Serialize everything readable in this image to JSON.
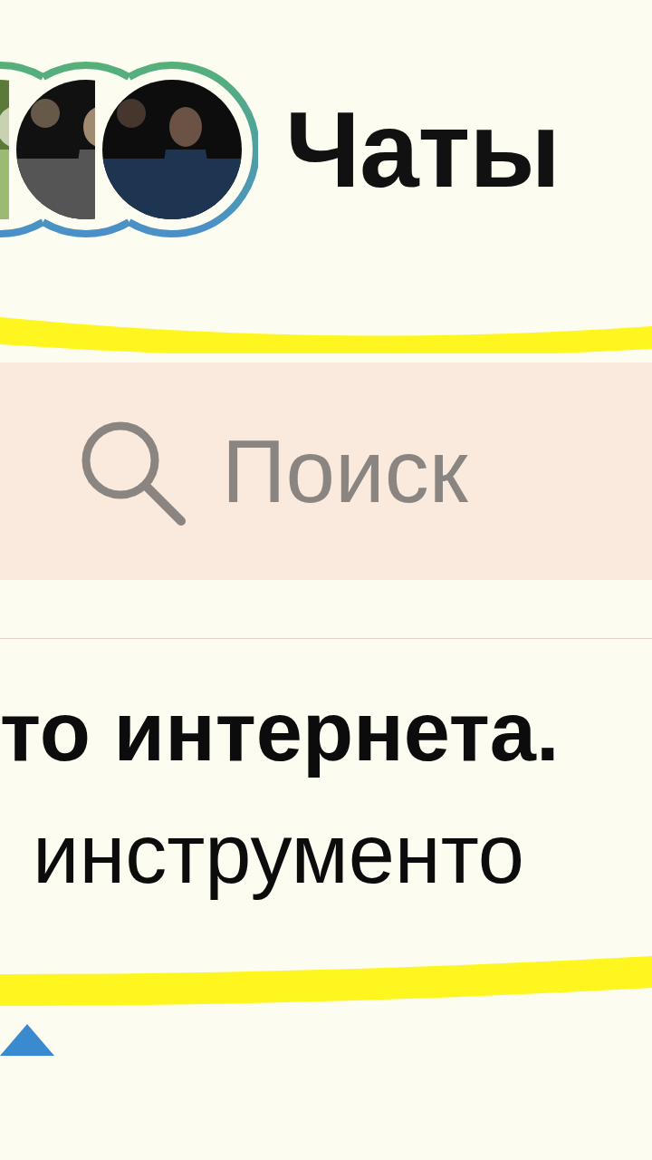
{
  "header": {
    "title": "Чаты"
  },
  "search": {
    "placeholder": "Поиск"
  },
  "chat_preview": {
    "title": "то интернета.",
    "text": "инструменто"
  }
}
